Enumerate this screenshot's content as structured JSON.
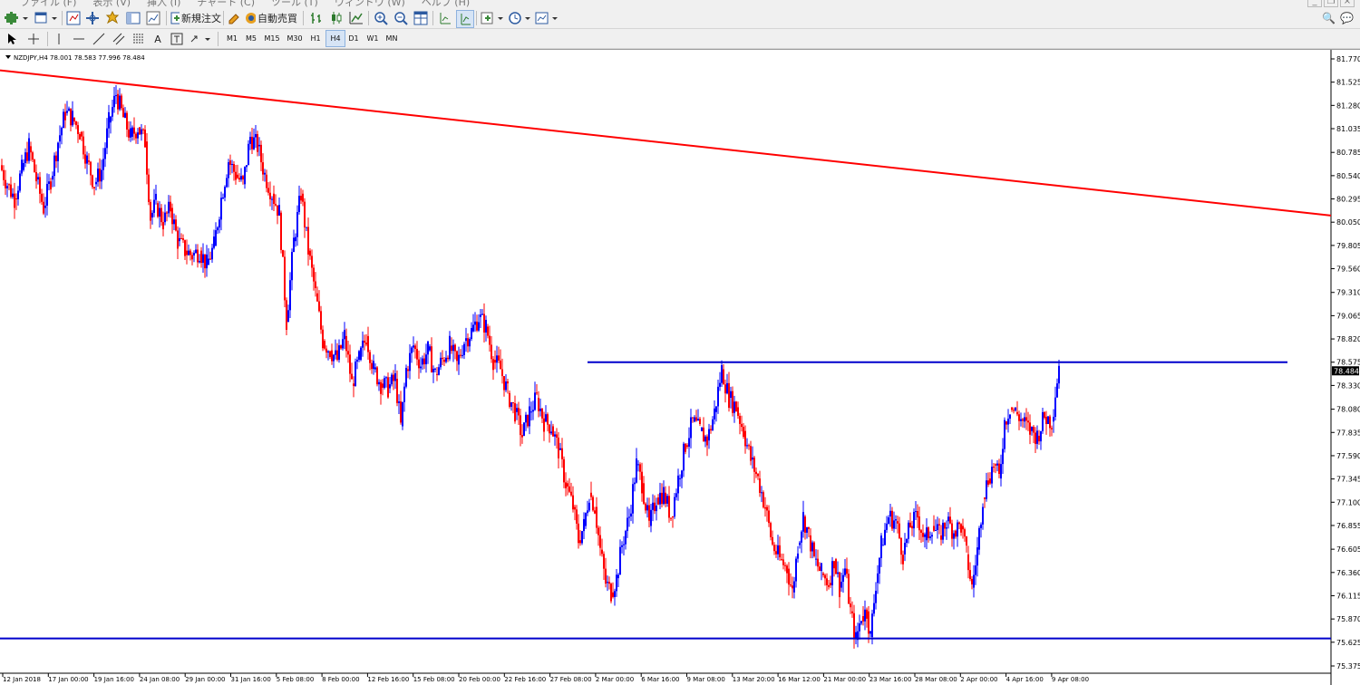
{
  "menu": {
    "items": [
      "ファイル (F)",
      "表示 (V)",
      "挿入 (I)",
      "チャート (C)",
      "ツール (T)",
      "ウィンドウ (W)",
      "ヘルプ (H)"
    ]
  },
  "toolbar": {
    "new_order_label": "新規注文",
    "auto_trading_label": "自動売買",
    "timeframes": [
      {
        "label": "M1",
        "active": false
      },
      {
        "label": "M5",
        "active": false
      },
      {
        "label": "M15",
        "active": false
      },
      {
        "label": "M30",
        "active": false
      },
      {
        "label": "H1",
        "active": false
      },
      {
        "label": "H4",
        "active": true
      },
      {
        "label": "D1",
        "active": false
      },
      {
        "label": "W1",
        "active": false
      },
      {
        "label": "MN",
        "active": false
      }
    ]
  },
  "chart": {
    "symbol_info": "NZDJPY,H4  78.001 78.583 77.996 78.484",
    "current_price_label": "78.484",
    "colors": {
      "bull": "#0000ff",
      "bear": "#ff0000",
      "trendline": "#ff0000",
      "hline": "#0000cc",
      "price_tag_bg": "#000000"
    }
  },
  "chart_data": {
    "type": "candlestick",
    "symbol": "NZDJPY",
    "timeframe": "H4",
    "ohlc_last": {
      "open": 78.001,
      "high": 78.583,
      "low": 77.996,
      "close": 78.484
    },
    "ylim": [
      75.3,
      81.9
    ],
    "y_ticks": [
      "81.770",
      "81.525",
      "81.280",
      "81.035",
      "80.785",
      "80.540",
      "80.295",
      "80.050",
      "79.805",
      "79.560",
      "79.310",
      "79.065",
      "78.820",
      "78.575",
      "78.330",
      "78.080",
      "77.835",
      "77.590",
      "77.345",
      "77.100",
      "76.855",
      "76.605",
      "76.360",
      "76.115",
      "75.870",
      "75.625",
      "75.375"
    ],
    "x_ticks": [
      "12 Jan 2018",
      "17 Jan 00:00",
      "19 Jan 16:00",
      "24 Jan 08:00",
      "29 Jan 00:00",
      "31 Jan 16:00",
      "5 Feb 08:00",
      "8 Feb 00:00",
      "12 Feb 16:00",
      "15 Feb 08:00",
      "20 Feb 00:00",
      "22 Feb 16:00",
      "27 Feb 08:00",
      "2 Mar 00:00",
      "6 Mar 16:00",
      "9 Mar 08:00",
      "13 Mar 20:00",
      "16 Mar 12:00",
      "21 Mar 00:00",
      "23 Mar 16:00",
      "28 Mar 08:00",
      "2 Apr 00:00",
      "4 Apr 16:00",
      "9 Apr 08:00"
    ],
    "path_points": [
      [
        0,
        80.65
      ],
      [
        8,
        80.45
      ],
      [
        16,
        80.3
      ],
      [
        24,
        80.6
      ],
      [
        32,
        80.85
      ],
      [
        40,
        80.5
      ],
      [
        48,
        80.2
      ],
      [
        56,
        80.5
      ],
      [
        64,
        80.9
      ],
      [
        72,
        81.2
      ],
      [
        80,
        81.15
      ],
      [
        88,
        81.0
      ],
      [
        96,
        80.7
      ],
      [
        104,
        80.45
      ],
      [
        112,
        80.6
      ],
      [
        120,
        81.1
      ],
      [
        128,
        81.4
      ],
      [
        136,
        81.15
      ],
      [
        144,
        80.95
      ],
      [
        152,
        81.05
      ],
      [
        160,
        80.9
      ],
      [
        166,
        80.1
      ],
      [
        172,
        80.25
      ],
      [
        180,
        80.05
      ],
      [
        188,
        80.2
      ],
      [
        196,
        79.85
      ],
      [
        204,
        79.75
      ],
      [
        212,
        79.7
      ],
      [
        220,
        79.75
      ],
      [
        228,
        79.6
      ],
      [
        236,
        79.8
      ],
      [
        244,
        80.3
      ],
      [
        252,
        80.7
      ],
      [
        260,
        80.55
      ],
      [
        268,
        80.45
      ],
      [
        276,
        80.95
      ],
      [
        284,
        80.85
      ],
      [
        292,
        80.55
      ],
      [
        300,
        80.35
      ],
      [
        308,
        80.15
      ],
      [
        316,
        79.0
      ],
      [
        324,
        79.85
      ],
      [
        332,
        80.35
      ],
      [
        340,
        79.75
      ],
      [
        348,
        79.3
      ],
      [
        356,
        78.8
      ],
      [
        364,
        78.7
      ],
      [
        372,
        78.6
      ],
      [
        380,
        78.85
      ],
      [
        388,
        78.35
      ],
      [
        396,
        78.6
      ],
      [
        404,
        78.85
      ],
      [
        412,
        78.5
      ],
      [
        420,
        78.35
      ],
      [
        428,
        78.3
      ],
      [
        436,
        78.4
      ],
      [
        442,
        77.9
      ],
      [
        448,
        78.5
      ],
      [
        456,
        78.75
      ],
      [
        464,
        78.55
      ],
      [
        472,
        78.7
      ],
      [
        480,
        78.45
      ],
      [
        488,
        78.6
      ],
      [
        496,
        78.75
      ],
      [
        504,
        78.55
      ],
      [
        512,
        78.8
      ],
      [
        520,
        78.9
      ],
      [
        528,
        79.05
      ],
      [
        536,
        78.95
      ],
      [
        544,
        78.6
      ],
      [
        552,
        78.5
      ],
      [
        560,
        78.25
      ],
      [
        568,
        78.05
      ],
      [
        576,
        77.8
      ],
      [
        584,
        78.05
      ],
      [
        592,
        78.2
      ],
      [
        600,
        77.95
      ],
      [
        608,
        77.9
      ],
      [
        616,
        77.65
      ],
      [
        624,
        77.3
      ],
      [
        632,
        77.05
      ],
      [
        638,
        76.7
      ],
      [
        644,
        76.85
      ],
      [
        650,
        77.2
      ],
      [
        656,
        77.05
      ],
      [
        662,
        76.6
      ],
      [
        668,
        76.25
      ],
      [
        674,
        76.15
      ],
      [
        680,
        76.3
      ],
      [
        686,
        76.65
      ],
      [
        694,
        76.95
      ],
      [
        702,
        77.5
      ],
      [
        708,
        77.3
      ],
      [
        716,
        76.85
      ],
      [
        724,
        77.15
      ],
      [
        732,
        77.2
      ],
      [
        740,
        76.95
      ],
      [
        748,
        77.35
      ],
      [
        756,
        77.7
      ],
      [
        764,
        77.95
      ],
      [
        772,
        77.85
      ],
      [
        780,
        77.75
      ],
      [
        788,
        78.05
      ],
      [
        796,
        78.5
      ],
      [
        804,
        78.2
      ],
      [
        812,
        78.1
      ],
      [
        820,
        77.85
      ],
      [
        828,
        77.55
      ],
      [
        836,
        77.35
      ],
      [
        844,
        77.05
      ],
      [
        852,
        76.65
      ],
      [
        860,
        76.5
      ],
      [
        868,
        76.4
      ],
      [
        874,
        76.15
      ],
      [
        880,
        76.65
      ],
      [
        886,
        76.95
      ],
      [
        892,
        76.75
      ],
      [
        898,
        76.5
      ],
      [
        906,
        76.35
      ],
      [
        914,
        76.25
      ],
      [
        920,
        76.5
      ],
      [
        926,
        76.2
      ],
      [
        932,
        76.4
      ],
      [
        938,
        75.95
      ],
      [
        944,
        75.65
      ],
      [
        950,
        75.9
      ],
      [
        956,
        75.95
      ],
      [
        960,
        75.68
      ],
      [
        966,
        76.25
      ],
      [
        972,
        76.65
      ],
      [
        980,
        76.95
      ],
      [
        988,
        76.9
      ],
      [
        996,
        76.55
      ],
      [
        1004,
        76.85
      ],
      [
        1012,
        76.95
      ],
      [
        1020,
        76.7
      ],
      [
        1028,
        76.85
      ],
      [
        1036,
        76.75
      ],
      [
        1044,
        76.9
      ],
      [
        1052,
        76.8
      ],
      [
        1060,
        76.85
      ],
      [
        1066,
        76.55
      ],
      [
        1072,
        76.2
      ],
      [
        1078,
        76.6
      ],
      [
        1084,
        77.15
      ],
      [
        1090,
        77.35
      ],
      [
        1096,
        77.5
      ],
      [
        1102,
        77.35
      ],
      [
        1108,
        77.95
      ],
      [
        1114,
        78.1
      ],
      [
        1120,
        78.05
      ],
      [
        1128,
        77.95
      ],
      [
        1136,
        77.85
      ],
      [
        1144,
        77.8
      ],
      [
        1152,
        78.0
      ],
      [
        1160,
        77.95
      ],
      [
        1168,
        78.55
      ]
    ],
    "trendline": {
      "x1": 0,
      "y1": 81.65,
      "x2": 1468,
      "y2": 80.12
    },
    "resistance_line": {
      "y": 78.575,
      "x1": 648,
      "x2": 1420
    },
    "support_line": {
      "y": 75.665,
      "x1": 0,
      "x2": 1468
    }
  }
}
